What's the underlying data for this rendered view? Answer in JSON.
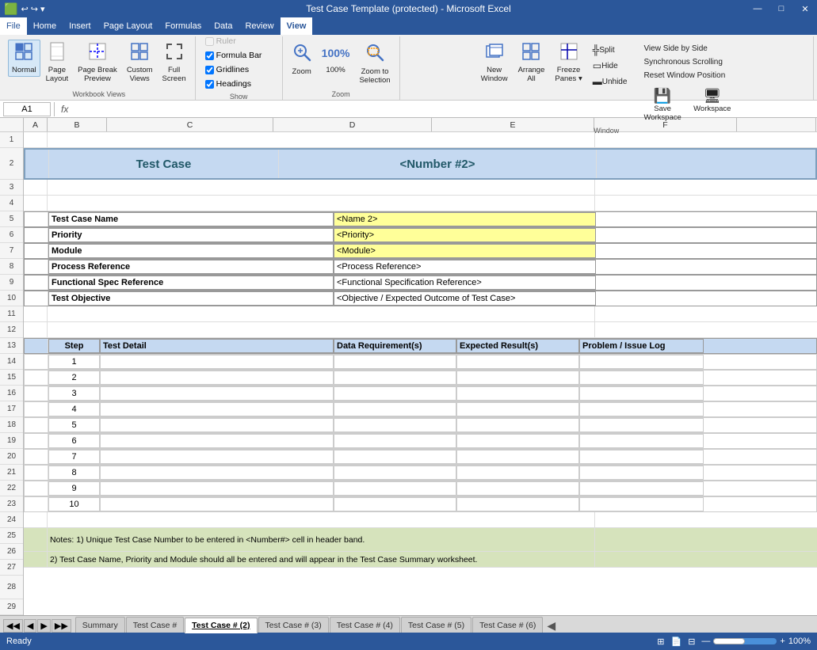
{
  "titleBar": {
    "title": "Test Case Template (protected) - Microsoft Excel",
    "controls": [
      "—",
      "□",
      "✕"
    ]
  },
  "menuBar": {
    "items": [
      "File",
      "Home",
      "Insert",
      "Page Layout",
      "Formulas",
      "Data",
      "Review",
      "View"
    ]
  },
  "ribbon": {
    "activeTab": "View",
    "workbookViews": {
      "label": "Workbook Views",
      "buttons": [
        {
          "id": "normal",
          "icon": "⊞",
          "label": "Normal",
          "active": true
        },
        {
          "id": "page-layout",
          "icon": "📄",
          "label": "Page\nLayout"
        },
        {
          "id": "page-break",
          "icon": "⊟",
          "label": "Page Break\nPreview"
        },
        {
          "id": "custom-views",
          "icon": "⊡",
          "label": "Custom\nViews"
        },
        {
          "id": "full-screen",
          "icon": "⛶",
          "label": "Full\nScreen"
        }
      ]
    },
    "show": {
      "label": "Show",
      "checkboxes": [
        {
          "id": "ruler",
          "label": "Ruler",
          "checked": false,
          "disabled": true
        },
        {
          "id": "formula-bar",
          "label": "Formula Bar",
          "checked": true
        },
        {
          "id": "gridlines",
          "label": "Gridlines",
          "checked": true
        },
        {
          "id": "headings",
          "label": "Headings",
          "checked": true
        }
      ]
    },
    "zoom": {
      "label": "Zoom",
      "buttons": [
        {
          "id": "zoom-btn",
          "icon": "🔍",
          "label": "Zoom"
        },
        {
          "id": "zoom-100",
          "icon": "①",
          "label": "100%"
        },
        {
          "id": "zoom-selection",
          "icon": "🔎",
          "label": "Zoom to\nSelection"
        }
      ]
    },
    "window": {
      "label": "Window",
      "buttons": [
        {
          "id": "new-window",
          "icon": "⬜",
          "label": "New\nWindow"
        },
        {
          "id": "arrange-all",
          "icon": "⧉",
          "label": "Arrange\nAll"
        },
        {
          "id": "freeze-panes",
          "icon": "⬛",
          "label": "Freeze\nPanes ▾"
        },
        {
          "id": "split",
          "icon": "╬",
          "label": "Split"
        },
        {
          "id": "hide",
          "icon": "👁",
          "label": "Hide"
        },
        {
          "id": "unhide",
          "icon": "👁",
          "label": "Unhide"
        }
      ],
      "rightButtons": [
        {
          "id": "view-side-by-side",
          "label": "View Side by Side"
        },
        {
          "id": "synchronous-scroll",
          "label": "Synchronous Scrolling"
        },
        {
          "id": "reset-position",
          "label": "Reset Window Position"
        },
        {
          "id": "save-workspace",
          "label": "Save\nWorkspace"
        },
        {
          "id": "workspace",
          "label": "Workspace"
        }
      ]
    }
  },
  "formulaBar": {
    "cellRef": "A1",
    "formula": ""
  },
  "columns": [
    "A",
    "B",
    "C",
    "D",
    "E",
    "F"
  ],
  "spreadsheet": {
    "headerRow": {
      "title": "Test Case",
      "number": "<Number #2>"
    },
    "infoRows": [
      {
        "label": "Test Case Name",
        "value": "<Name 2>",
        "yellow": true
      },
      {
        "label": "Priority",
        "value": "<Priority>",
        "yellow": true
      },
      {
        "label": "Module",
        "value": "<Module>",
        "yellow": true
      },
      {
        "label": "Process Reference",
        "value": "<Process Reference>"
      },
      {
        "label": "Functional Spec Reference",
        "value": "<Functional Specification Reference>"
      },
      {
        "label": "Test Objective",
        "value": "<Objective / Expected Outcome of Test Case>"
      }
    ],
    "tableHeaders": [
      "Step",
      "Test Detail",
      "Data Requirement(s)",
      "Expected Result(s)",
      "Problem / Issue Log"
    ],
    "tableRows": [
      1,
      2,
      3,
      4,
      5,
      6,
      7,
      8,
      9,
      10
    ],
    "notes": "Notes:   1) Unique Test Case Number to be entered in <Number#> cell in header band.",
    "notes2": "          2) Test Case Name, Priority and Module should all be entered and will appear in the Test Case Summary worksheet."
  },
  "sheets": [
    {
      "id": "summary",
      "label": "Summary",
      "active": false
    },
    {
      "id": "test-case",
      "label": "Test Case #",
      "active": false
    },
    {
      "id": "test-case-2",
      "label": "Test Case # (2)",
      "active": true
    },
    {
      "id": "test-case-3",
      "label": "Test Case # (3)",
      "active": false
    },
    {
      "id": "test-case-4",
      "label": "Test Case # (4)",
      "active": false
    },
    {
      "id": "test-case-5",
      "label": "Test Case # (5)",
      "active": false
    },
    {
      "id": "test-case-6",
      "label": "Test Case # (6)",
      "active": false
    }
  ],
  "statusBar": {
    "left": "Ready",
    "right": ""
  }
}
